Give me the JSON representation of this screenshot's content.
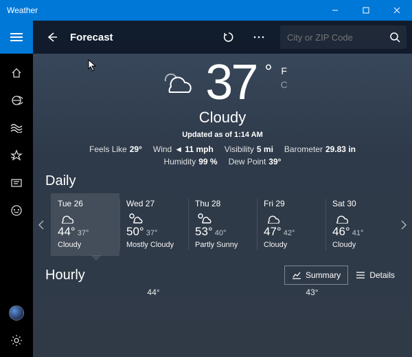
{
  "window": {
    "title": "Weather"
  },
  "topbar": {
    "page_label": "Forecast",
    "search_placeholder": "City or ZIP Code"
  },
  "current": {
    "temp": "37",
    "degree": "°",
    "unit_f": "F",
    "unit_c": "C",
    "condition": "Cloudy",
    "updated": "Updated as of 1:14 AM",
    "metrics": [
      {
        "k": "Feels Like",
        "v": "29°"
      },
      {
        "k": "Wind",
        "v": "◄ 11 mph"
      },
      {
        "k": "Visibility",
        "v": "5 mi"
      },
      {
        "k": "Barometer",
        "v": "29.83 in"
      },
      {
        "k": "Humidity",
        "v": "99 %"
      },
      {
        "k": "Dew Point",
        "v": "39°"
      }
    ]
  },
  "daily": {
    "title": "Daily",
    "days": [
      {
        "date": "Tue 26",
        "hi": "44°",
        "lo": "37°",
        "cond": "Cloudy",
        "icon": "cloud"
      },
      {
        "date": "Wed 27",
        "hi": "50°",
        "lo": "37°",
        "cond": "Mostly Cloudy",
        "icon": "partly"
      },
      {
        "date": "Thu 28",
        "hi": "53°",
        "lo": "40°",
        "cond": "Partly Sunny",
        "icon": "partly"
      },
      {
        "date": "Fri 29",
        "hi": "47°",
        "lo": "42°",
        "cond": "Cloudy",
        "icon": "cloud"
      },
      {
        "date": "Sat 30",
        "hi": "46°",
        "lo": "41°",
        "cond": "Cloudy",
        "icon": "cloud"
      }
    ]
  },
  "hourly": {
    "title": "Hourly",
    "summary_label": "Summary",
    "details_label": "Details",
    "preview_temps": [
      "44°",
      "43°"
    ]
  },
  "icons": {
    "sidebar": [
      "home",
      "news",
      "maps",
      "favorites",
      "history",
      "feedback"
    ]
  },
  "colors": {
    "accent": "#0078D7"
  }
}
